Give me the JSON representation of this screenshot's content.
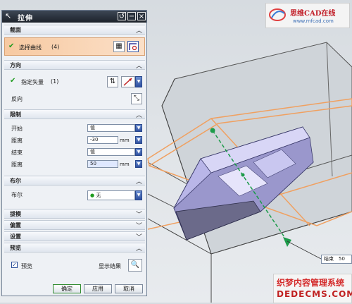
{
  "dialog": {
    "title": "拉伸",
    "section_profile": "截面",
    "select_curve": "选择曲线",
    "select_curve_count": "(4)",
    "section_direction": "方向",
    "specify_vector": "指定矢量",
    "specify_vector_count": "(1)",
    "reverse": "反向",
    "section_limits": "限制",
    "start_label": "开始",
    "start_value": "值",
    "start_distance_label": "距离",
    "start_distance": "-30",
    "end_label": "结束",
    "end_value": "值",
    "end_distance_label": "距离",
    "end_distance": "50",
    "unit": "mm",
    "section_boolean": "布尔",
    "boolean_label": "布尔",
    "boolean_value": "无",
    "section_draft": "拔模",
    "section_offset": "偏置",
    "section_settings": "设置",
    "section_preview": "预览",
    "preview_label": "预览",
    "show_result": "显示结果",
    "ok": "确定",
    "apply": "应用",
    "cancel": "取消"
  },
  "canvas": {
    "end_tag_label": "结束",
    "end_tag_value": "50"
  },
  "watermark_top": {
    "text": "思维CAD在线",
    "url": "www.mfcad.com"
  },
  "watermark_bottom": {
    "text": "织梦内容管理系统",
    "url": "DEDECMS.COM"
  },
  "colors": {
    "accent_orange": "#f0a060",
    "titlebar": "#2a323c",
    "selection_bg": "#f6c9a0",
    "solid": "#b9b6e8"
  }
}
